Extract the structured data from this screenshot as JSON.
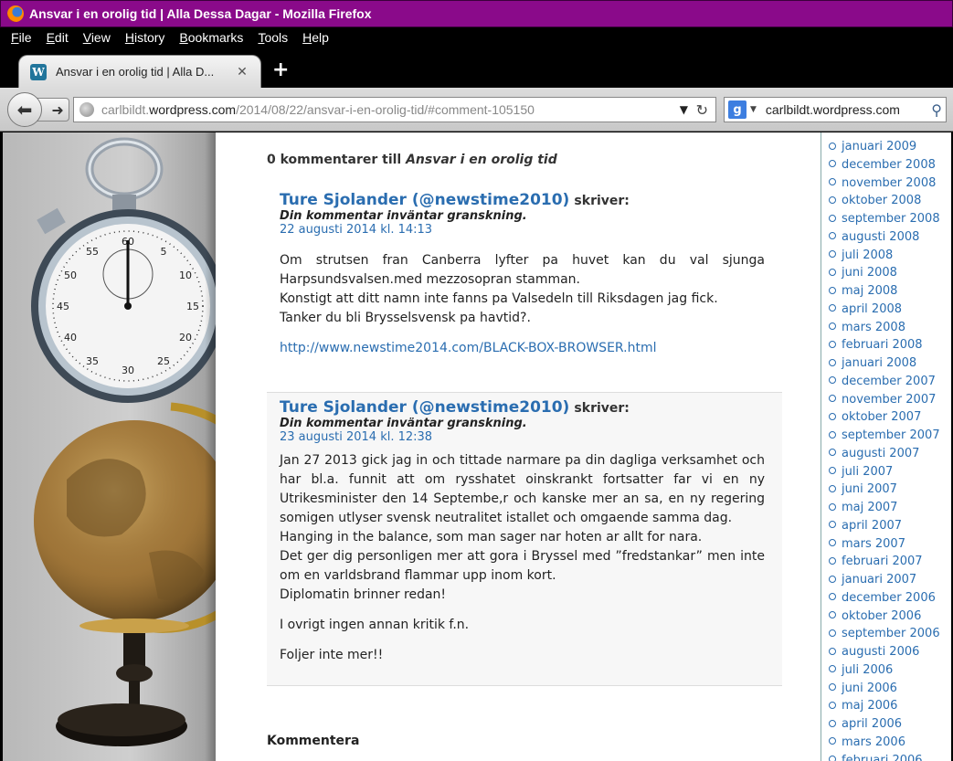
{
  "window": {
    "title": "Ansvar i en orolig tid | Alla Dessa Dagar - Mozilla Firefox"
  },
  "menu": [
    "File",
    "Edit",
    "View",
    "History",
    "Bookmarks",
    "Tools",
    "Help"
  ],
  "tab": {
    "label": "Ansvar i en orolig tid | Alla D...",
    "new_tab_label": "+"
  },
  "nav": {
    "url_domain_prefix": "carlbildt.",
    "url_domain": "wordpress.com",
    "url_path": "/2014/08/22/ansvar-i-en-orolig-tid/#comment-105150",
    "search_engine": "g",
    "search_text": "carlbildt.wordpress.com"
  },
  "page": {
    "comments_heading_prefix": "0 kommentarer till ",
    "comments_heading_title": "Ansvar i en orolig tid",
    "comments": [
      {
        "author": "Ture Sjolander (@newstime2010)",
        "says": "skriver:",
        "moderation": "Din kommentar inväntar granskning.",
        "date": "22 augusti 2014 kl. 14:13",
        "paragraphs": [
          "Om strutsen fran Canberra lyfter pa huvet kan du val sjunga Harpsundsvalsen.med mezzosopran stamman.",
          "Konstigt att ditt namn inte fanns pa Valsedeln till Riksdagen jag fick.",
          "Tanker du bli Brysselsvensk pa havtid?."
        ],
        "link": "http://www.newstime2014.com/BLACK-BOX-BROWSER.html"
      },
      {
        "author": "Ture Sjolander (@newstime2010)",
        "says": "skriver:",
        "moderation": "Din kommentar inväntar granskning.",
        "date": "23 augusti 2014 kl. 12:38",
        "paragraphs": [
          "Jan 27 2013 gick jag in och tittade narmare pa din dagliga verksamhet och har bl.a. funnit att om rysshatet oinskrankt fortsatter far vi en ny Utrikesminister den 14 Septembe,r och kanske mer an sa, en ny regering somigen utlyser svensk neutralitet istallet och omgaende samma dag.",
          "Hanging in the balance, som man sager nar hoten ar allt for nara.",
          "Det ger dig personligen mer att gora i Bryssel med ”fredstankar” men inte om en varldsbrand flammar upp inom kort.",
          "Diplomatin brinner redan!",
          "I ovrigt ingen annan kritik f.n.",
          "Foljer inte mer!!"
        ]
      }
    ],
    "respond_heading": "Kommentera"
  },
  "archive": [
    "januari 2009",
    "december 2008",
    "november 2008",
    "oktober 2008",
    "september 2008",
    "augusti 2008",
    "juli 2008",
    "juni 2008",
    "maj 2008",
    "april 2008",
    "mars 2008",
    "februari 2008",
    "januari 2008",
    "december 2007",
    "november 2007",
    "oktober 2007",
    "september 2007",
    "augusti 2007",
    "juli 2007",
    "juni 2007",
    "maj 2007",
    "april 2007",
    "mars 2007",
    "februari 2007",
    "januari 2007",
    "december 2006",
    "oktober 2006",
    "september 2006",
    "augusti 2006",
    "juli 2006",
    "juni 2006",
    "maj 2006",
    "april 2006",
    "mars 2006",
    "februari 2006"
  ],
  "colors": {
    "titlebar": "#8a0a8a",
    "link": "#2a6db0"
  }
}
